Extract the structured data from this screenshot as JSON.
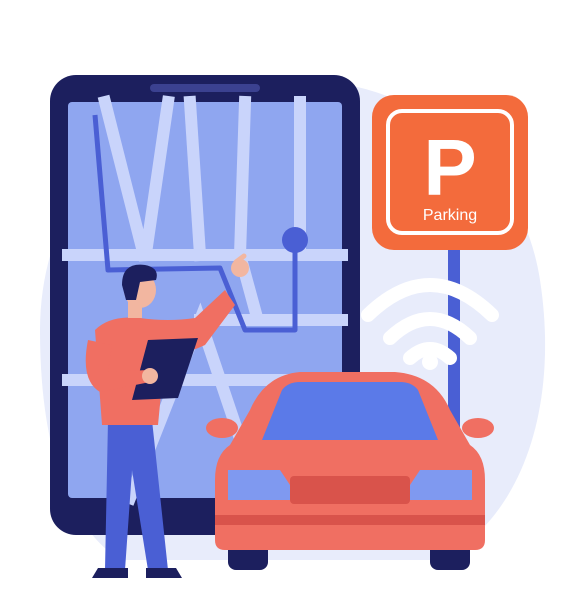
{
  "sign": {
    "letter": "P",
    "label": "Parking"
  },
  "colors": {
    "phone_frame": "#1c1f5e",
    "map_screen": "#8fa6f0",
    "map_road": "#c9d4fb",
    "route": "#4a5fd4",
    "sign_orange": "#f36b3c",
    "car_body": "#f06f62",
    "car_window": "#5b7ae8",
    "person_shirt": "#f06f62",
    "person_pants": "#4a5fd4",
    "background_blob": "#e8ecfb"
  }
}
